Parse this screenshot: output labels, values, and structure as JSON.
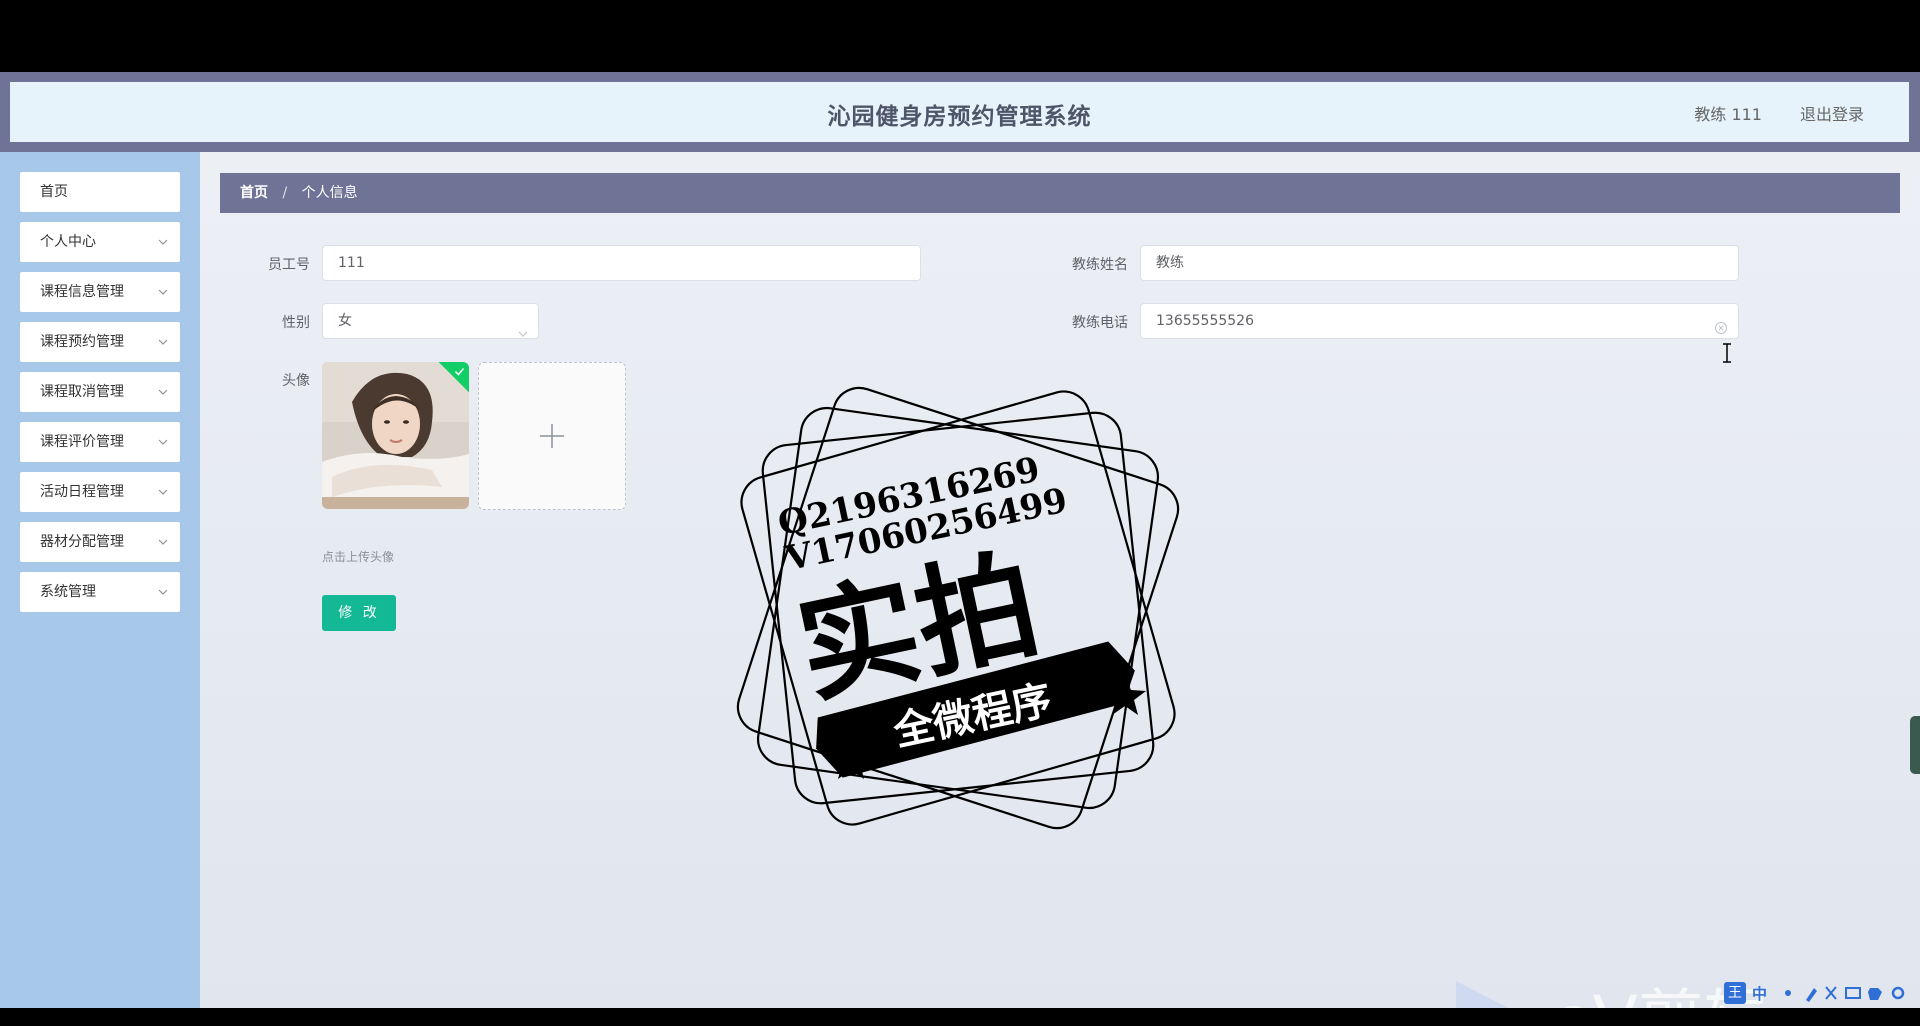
{
  "header": {
    "title": "沁园健身房预约管理系统",
    "user_label": "教练 111",
    "logout_label": "退出登录"
  },
  "sidebar": {
    "items": [
      {
        "label": "首页",
        "has_children": false
      },
      {
        "label": "个人中心",
        "has_children": true
      },
      {
        "label": "课程信息管理",
        "has_children": true
      },
      {
        "label": "课程预约管理",
        "has_children": true
      },
      {
        "label": "课程取消管理",
        "has_children": true
      },
      {
        "label": "课程评价管理",
        "has_children": true
      },
      {
        "label": "活动日程管理",
        "has_children": true
      },
      {
        "label": "器材分配管理",
        "has_children": true
      },
      {
        "label": "系统管理",
        "has_children": true
      }
    ]
  },
  "breadcrumb": {
    "home": "首页",
    "separator": "/",
    "current": "个人信息"
  },
  "form": {
    "employee_id_label": "员工号",
    "employee_id_value": "111",
    "coach_name_label": "教练姓名",
    "coach_name_value": "教练",
    "gender_label": "性别",
    "gender_value": "女",
    "coach_phone_label": "教练电话",
    "coach_phone_value": "13655555526",
    "avatar_label": "头像",
    "upload_hint": "点击上传头像",
    "submit_label": "修 改"
  },
  "overlays": {
    "stamp_line_1": "Q2196316269",
    "stamp_line_2": "V17060256499",
    "stamp_big_text": "实拍",
    "stamp_banner_text": "全微程序",
    "ev_watermark_text": "eV剪辑",
    "ime_badge": "王",
    "ime_mode": "中"
  },
  "colors": {
    "header_bar": "#6f7396",
    "header_bg": "#e6f3fb",
    "sidebar_bg": "#a8c8ea",
    "breadcrumb_bg": "#6f7396",
    "primary_button": "#13b995",
    "upload_check_badge": "#13ce66"
  }
}
